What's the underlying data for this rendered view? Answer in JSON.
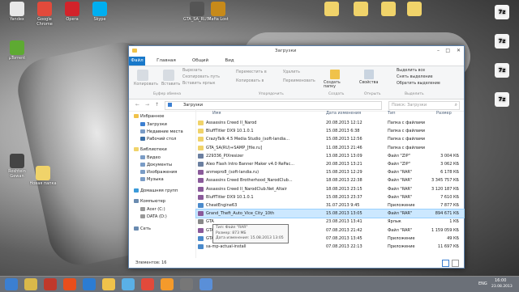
{
  "desktop": {
    "icons_left": [
      {
        "label": "Yandex",
        "color": "#e8e8e8"
      },
      {
        "label": "Google Chrome",
        "color": "#e24a3b"
      },
      {
        "label": "Opera",
        "color": "#d2232a"
      },
      {
        "label": "Skype",
        "color": "#00aff0"
      },
      {
        "label": "µTorrent",
        "color": "#5eaa32"
      },
      {
        "label": "Новая папка",
        "color": "#f0d36a"
      },
      {
        "label": "Roshtein Gewan",
        "color": "#444"
      }
    ],
    "icons_top": [
      {
        "label": "GTA_SA_RUSSIA...",
        "color": "#555"
      },
      {
        "label": "Mafia Lost",
        "color": "#c78a1a"
      },
      {
        "label": "",
        "color": "#f0d36a"
      },
      {
        "label": "",
        "color": "#f0d36a"
      },
      {
        "label": "",
        "color": "#f0d36a"
      },
      {
        "label": "",
        "color": "#f0d36a"
      }
    ],
    "icons_right": [
      {
        "label": "7z"
      },
      {
        "label": "7z"
      },
      {
        "label": "7z"
      },
      {
        "label": "7z"
      }
    ]
  },
  "window": {
    "title": "Загрузки",
    "tabs": [
      "Файл",
      "Главная",
      "Общий доступ",
      "Вид"
    ],
    "ribbon": {
      "copy": "Копировать",
      "paste": "Вставить",
      "cut": "Вырезать",
      "copy_path": "Скопировать путь",
      "paste_shortcut": "Вставить ярлык",
      "move_to": "Переместить в",
      "copy_to": "Копировать в",
      "delete": "Удалить",
      "rename": "Переименовать",
      "new_folder": "Создать папку",
      "properties": "Свойства",
      "select_all": "Выделить все",
      "select_none": "Снять выделение",
      "invert": "Обратить выделение",
      "groups": [
        "Буфер обмена",
        "Упорядочить",
        "Создать",
        "Открыть",
        "Выделить"
      ]
    },
    "address": "Загрузки",
    "search_placeholder": "Поиск: Загрузки",
    "nav": [
      {
        "label": "Избранное",
        "color": "#f0c24a"
      },
      {
        "label": "Загрузки",
        "color": "#3b7fd1"
      },
      {
        "label": "Недавние места",
        "color": "#7a9cc6"
      },
      {
        "label": "Рабочий стол",
        "color": "#3a6ea5"
      },
      {
        "label": "Библиотеки",
        "color": "#f0d36a"
      },
      {
        "label": "Видео",
        "color": "#7a9cc6"
      },
      {
        "label": "Документы",
        "color": "#7a9cc6"
      },
      {
        "label": "Изображения",
        "color": "#7a9cc6"
      },
      {
        "label": "Музыка",
        "color": "#7a9cc6"
      },
      {
        "label": "Домашняя групп",
        "color": "#3a9ad9"
      },
      {
        "label": "Компьютер",
        "color": "#6a8bb0"
      },
      {
        "label": "Acer (C:)",
        "color": "#999"
      },
      {
        "label": "DATA (D:)",
        "color": "#999"
      },
      {
        "label": "Сеть",
        "color": "#6a8bb0"
      }
    ],
    "columns": [
      "Имя",
      "Дата изменения",
      "Тип",
      "Размер"
    ],
    "files": [
      {
        "name": "Assassins Creed II_Narod",
        "date": "20.08.2013 12:12",
        "type": "Папка с файлами",
        "size": "",
        "color": "#f0d36a"
      },
      {
        "name": "BluffTitler DX9 10.1.0.1",
        "date": "15.08.2013 6:38",
        "type": "Папка с файлами",
        "size": "",
        "color": "#f0d36a"
      },
      {
        "name": "CrazyTalk 4.5 Media Studio_(soft-landia...",
        "date": "15.08.2013 12:56",
        "type": "Папка с файлами",
        "size": "",
        "color": "#f0d36a"
      },
      {
        "name": "GTA_SA(RU)+SAMP_[file.ru]",
        "date": "11.08.2013 21:46",
        "type": "Папка с файлами",
        "size": "",
        "color": "#f0d36a"
      },
      {
        "name": "229336_PIXresizer",
        "date": "13.08.2013 13:09",
        "type": "Файл \"ZIP\"",
        "size": "3 004 КБ",
        "color": "#6b7fa0"
      },
      {
        "name": "Aleo Flash Intro Banner Maker v4.0 RePac...",
        "date": "20.08.2013 13:21",
        "type": "Файл \"ZIP\"",
        "size": "3 062 КБ",
        "color": "#6b7fa0"
      },
      {
        "name": "anmepro8_(soft-landia.ru)",
        "date": "15.08.2013 12:29",
        "type": "Файл \"RAR\"",
        "size": "6 178 КБ",
        "color": "#8a5a9a"
      },
      {
        "name": "Assassins Creed Brotherhood_NarodClub...",
        "date": "18.08.2013 22:38",
        "type": "Файл \"RAR\"",
        "size": "3 345 757 КБ",
        "color": "#8a5a9a"
      },
      {
        "name": "Assassins Creed II_NarodClub.Net_Altair",
        "date": "18.08.2013 23:15",
        "type": "Файл \"RAR\"",
        "size": "3 120 187 КБ",
        "color": "#8a5a9a"
      },
      {
        "name": "BluffTitler DX9 10.1.0.1",
        "date": "15.08.2013 23:37",
        "type": "Файл \"RAR\"",
        "size": "7 610 КБ",
        "color": "#8a5a9a"
      },
      {
        "name": "CheatEngine63",
        "date": "31.07.2013 9:45",
        "type": "Приложение",
        "size": "7 877 КБ",
        "color": "#4a8acb"
      },
      {
        "name": "Grand_Theft_Auto_Vice_City_10th",
        "date": "15.08.2013 13:05",
        "type": "Файл \"RAR\"",
        "size": "894 671 КБ",
        "color": "#8a5a9a"
      },
      {
        "name": "GTA",
        "date": "23.08.2013 13:41",
        "type": "Ярлык",
        "size": "1 КБ",
        "color": "#888"
      },
      {
        "name": "GTA",
        "date": "07.08.2013 21:42",
        "type": "Файл \"RAR\"",
        "size": "1 159 059 КБ",
        "color": "#8a5a9a"
      },
      {
        "name": "GTA",
        "date": "07.08.2013 13:45",
        "type": "Приложение",
        "size": "49 КБ",
        "color": "#4a8acb"
      },
      {
        "name": "sa-mp-actual-install",
        "date": "07.08.2013 22:13",
        "type": "Приложение",
        "size": "11 697 КБ",
        "color": "#4a8acb"
      }
    ],
    "selected_index": 11,
    "status": "Элементов: 16",
    "tooltip": {
      "line1": "Тип: Файл \"RAR\"",
      "line2": "Размер: 873 МБ",
      "line3": "Дата изменения: 15.08.2013 13:05"
    }
  },
  "taskbar": {
    "lang": "ENG",
    "time": "16:00",
    "date": "23.08.2013",
    "apps": [
      "#3b7fd1",
      "#d9b84a",
      "#c0392b",
      "#e94e1b",
      "#2b7cd3",
      "#f0c24a",
      "#5ab0e6",
      "#e24a3b",
      "#f49a2b",
      "#777",
      "#5a8fd8"
    ]
  }
}
